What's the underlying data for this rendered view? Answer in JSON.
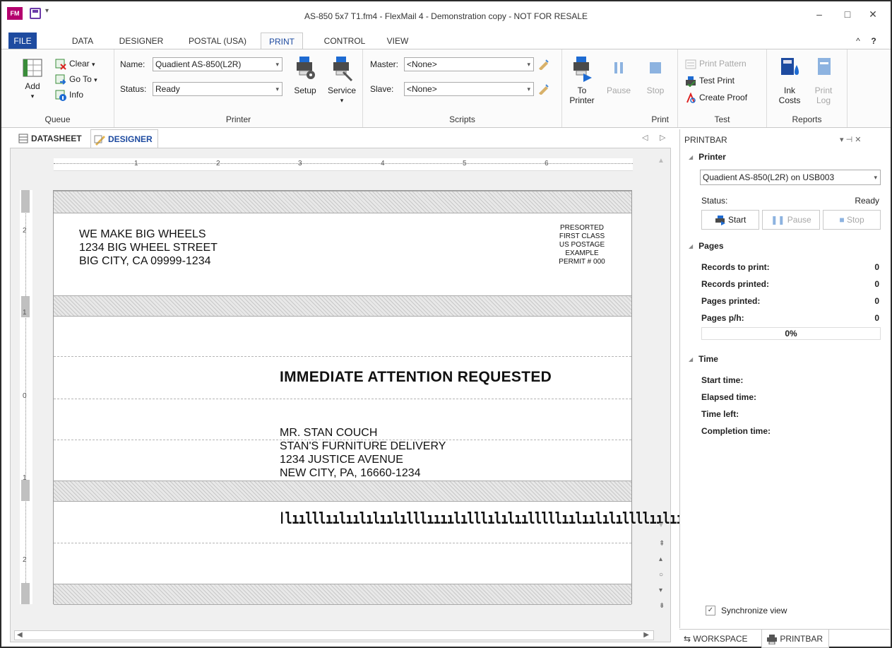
{
  "window": {
    "title": "AS-850 5x7 T1.fm4 - FlexMail 4 - Demonstration copy - NOT FOR RESALE",
    "logo": "FM",
    "min": "–",
    "max": "□",
    "close": "✕",
    "collapse": "^",
    "help": "?"
  },
  "tabs": [
    "FILE",
    "DATA",
    "DESIGNER",
    "POSTAL (USA)",
    "PRINT",
    "CONTROL",
    "VIEW"
  ],
  "ribbon": {
    "queue": {
      "add": "Add",
      "clear": "Clear",
      "goto": "Go To",
      "info": "Info",
      "label": "Queue"
    },
    "printer": {
      "name_label": "Name:",
      "name_value": "Quadient AS-850(L2R)",
      "status_label": "Status:",
      "status_value": "Ready",
      "setup": "Setup",
      "service": "Service",
      "label": "Printer"
    },
    "scripts": {
      "master_label": "Master:",
      "master_value": "<None>",
      "slave_label": "Slave:",
      "slave_value": "<None>",
      "label": "Scripts"
    },
    "print": {
      "to_printer_1": "To",
      "to_printer_2": "Printer",
      "pause": "Pause",
      "stop": "Stop",
      "label": "Print"
    },
    "test": {
      "print_pattern": "Print Pattern",
      "test_print": "Test Print",
      "create_proof": "Create Proof",
      "label": "Test"
    },
    "reports": {
      "ink_costs_1": "Ink",
      "ink_costs_2": "Costs",
      "print_log_1": "Print",
      "print_log_2": "Log",
      "label": "Reports"
    }
  },
  "doctabs": {
    "datasheet": "DATASHEET",
    "designer": "DESIGNER",
    "nav_left": "◁",
    "nav_right": "▷"
  },
  "ruler": {
    "h_marks": [
      "1",
      "2",
      "3",
      "4",
      "5",
      "6"
    ],
    "v_marks": [
      "2",
      "1",
      "0",
      "1",
      "2"
    ]
  },
  "envelope": {
    "return_address": [
      "WE MAKE BIG WHEELS",
      "1234 BIG WHEEL STREET",
      "BIG CITY, CA 09999-1234"
    ],
    "indicia": [
      "PRESORTED",
      "FIRST CLASS",
      "US POSTAGE",
      "EXAMPLE",
      "PERMIT # 000"
    ],
    "headline": "IMMEDIATE ATTENTION REQUESTED",
    "recipient": [
      "MR. STAN COUCH",
      "STAN'S FURNITURE DELIVERY",
      "1234 JUSTICE AVENUE",
      "NEW CITY, PA, 16660-1234"
    ],
    "barcode": "ǀlıılllıılıılılıılılllıııılılllılılıılllllıılıılılıllllıılıılı"
  },
  "printbar": {
    "title": "PRINTBAR",
    "pin": "▾  ⊣  ✕",
    "printer_section": "Printer",
    "printer_value": "Quadient AS-850(L2R) on USB003",
    "status_label": "Status:",
    "status_value": "Ready",
    "start": "Start",
    "pause": "Pause",
    "stop": "Stop",
    "pages_section": "Pages",
    "records_to_print_label": "Records to print:",
    "records_to_print": "0",
    "records_printed_label": "Records printed:",
    "records_printed": "0",
    "pages_printed_label": "Pages printed:",
    "pages_printed": "0",
    "pages_ph_label": "Pages p/h:",
    "pages_ph": "0",
    "progress": "0%",
    "time_section": "Time",
    "start_time": "Start time:",
    "elapsed_time": "Elapsed time:",
    "time_left": "Time left:",
    "completion_time": "Completion time:",
    "sync": "Synchronize view",
    "check": "✓"
  },
  "bottom_tabs": {
    "workspace": "WORKSPACE",
    "printbar": "PRINTBAR"
  },
  "colors": {
    "accent": "#1e4ba0",
    "file_tab": "#1e4ba0",
    "logo": "#b4006e"
  }
}
